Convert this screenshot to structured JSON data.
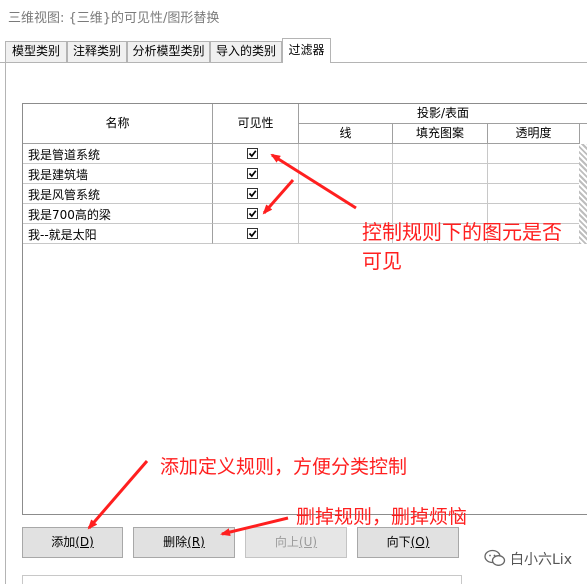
{
  "window": {
    "title": "三维视图: {三维}的可见性/图形替换"
  },
  "tabs": [
    {
      "label": "模型类别",
      "active": false
    },
    {
      "label": "注释类别",
      "active": false
    },
    {
      "label": "分析模型类别",
      "active": false
    },
    {
      "label": "导入的类别",
      "active": false
    },
    {
      "label": "过滤器",
      "active": true
    }
  ],
  "grid": {
    "headers": {
      "name": "名称",
      "visibility": "可见性",
      "projection_group": "投影/表面",
      "line": "线",
      "fill_pattern": "填充图案",
      "transparency": "透明度"
    },
    "rows": [
      {
        "name": "我是管道系统",
        "visible": true
      },
      {
        "name": "我是建筑墙",
        "visible": true
      },
      {
        "name": "我是风管系统",
        "visible": true
      },
      {
        "name": "我是700高的梁",
        "visible": true
      },
      {
        "name": "我--就是太阳",
        "visible": true
      }
    ]
  },
  "buttons": {
    "add": {
      "label": "添加",
      "mnemonic": "(D)"
    },
    "delete": {
      "label": "删除",
      "mnemonic": "(R)"
    },
    "up": {
      "label": "向上",
      "mnemonic": "(U)",
      "enabled": false
    },
    "down": {
      "label": "向下",
      "mnemonic": "(O)"
    }
  },
  "annotations": {
    "visibility_note_line1": "控制规则下的图元是否",
    "visibility_note_line2": "可见",
    "add_note": "添加定义规则，方便分类控制",
    "delete_note": "删掉规则，删掉烦恼",
    "color": "#ff1f1f"
  },
  "watermark": {
    "text": "白小六Lix",
    "icon": "wechat-icon"
  }
}
